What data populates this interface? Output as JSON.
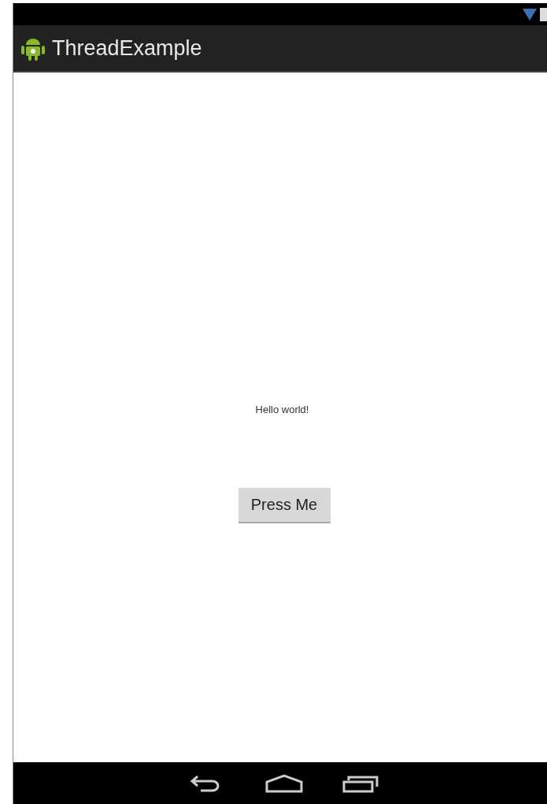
{
  "app_bar": {
    "title": "ThreadExample"
  },
  "content": {
    "message": "Hello world!",
    "button": "Press Me"
  }
}
